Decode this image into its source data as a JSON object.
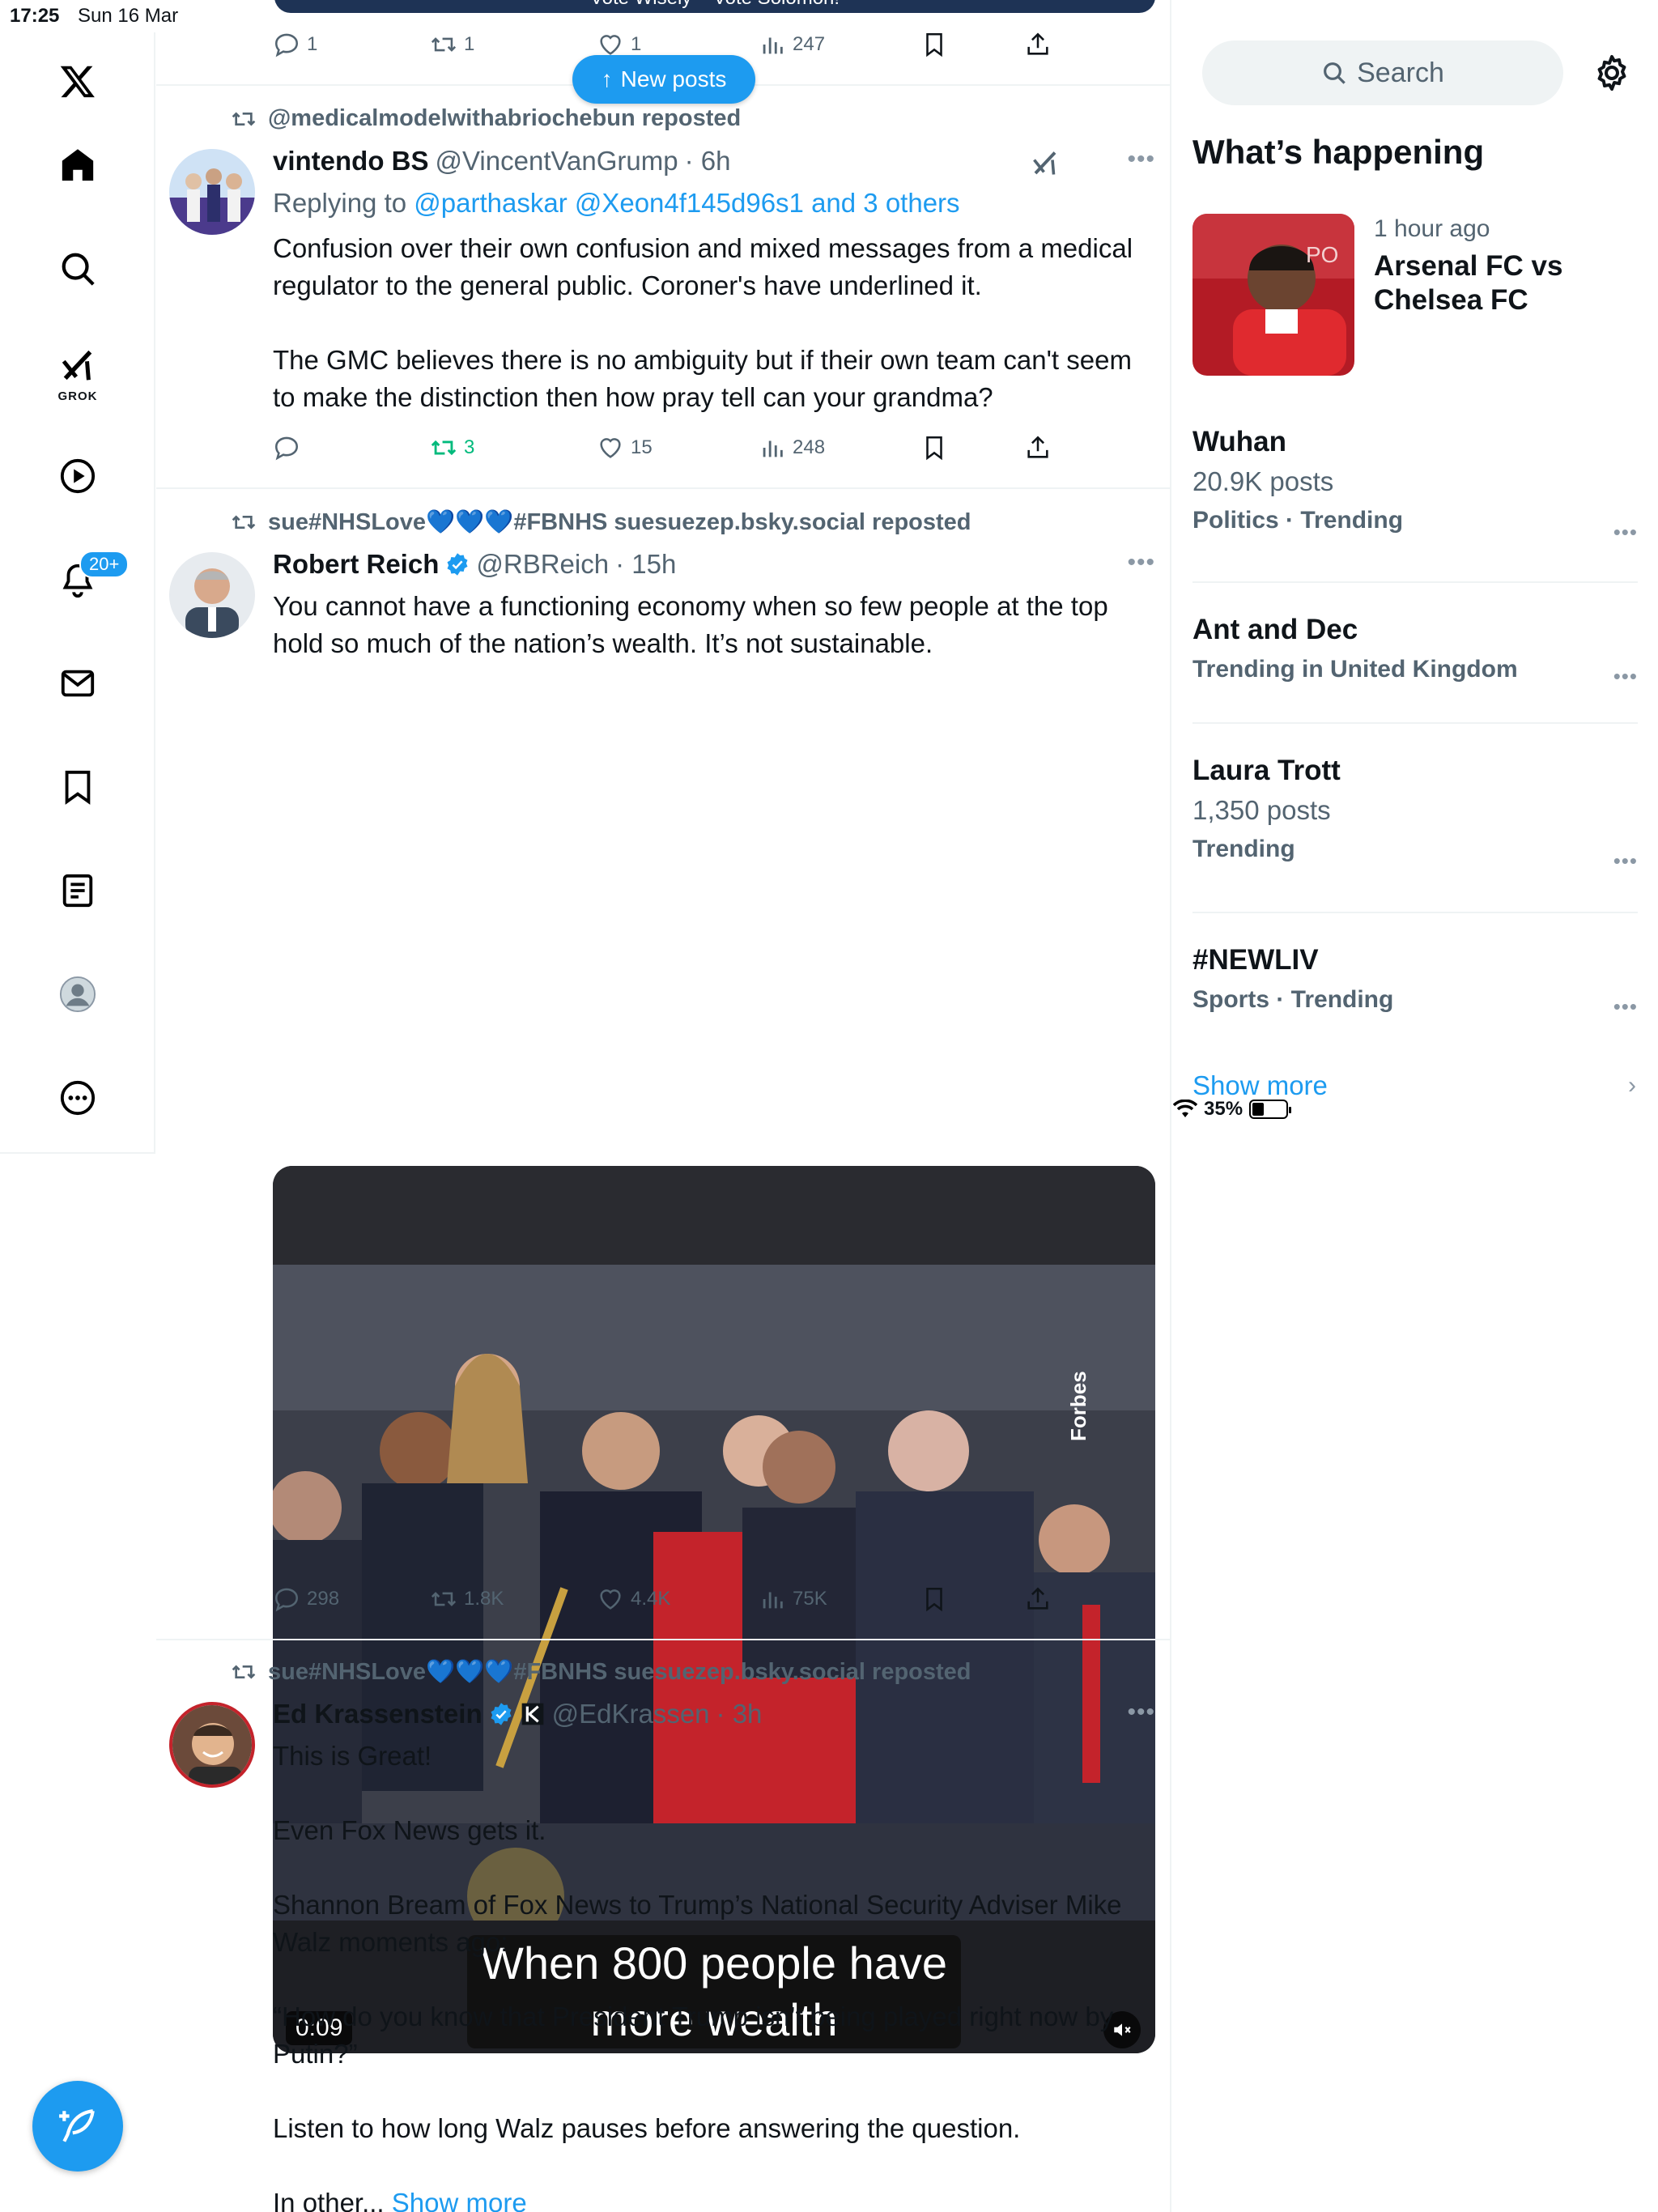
{
  "status_bar": {
    "time": "17:25",
    "date": "Sun 16 Mar",
    "battery": "35%",
    "battery_level": 0.35
  },
  "nav": {
    "notifications_badge": "20+",
    "grok_label": "GROK"
  },
  "banner": {
    "text": "Vote Wisely – Vote Solomon!"
  },
  "new_posts": {
    "label": "New posts"
  },
  "top_actions": {
    "replies": "1",
    "reposts": "1",
    "likes": "1",
    "views": "247"
  },
  "posts": [
    {
      "repost_by": "@medicalmodelwithabriochebun reposted",
      "name": "vintendo BS",
      "handle": "@VincentVanGrump",
      "time": "· 6h",
      "replying_prefix": "Replying to ",
      "replying_to": "@parthaskar @Xeon4f145d96s1 and 3 others",
      "body": [
        "Confusion over their own confusion and mixed messages from a medical regulator to the general public. Coroner's have underlined it.",
        "The GMC believes there is no ambiguity but if their own team can't seem to make the distinction then how pray tell can your grandma?"
      ],
      "actions": {
        "replies": "",
        "reposts": "3",
        "likes": "15",
        "views": "248"
      }
    },
    {
      "repost_by": "sue#NHSLove💙💙💙#FBNHS suesuezep.bsky.social reposted",
      "name": "Robert Reich",
      "handle": "@RBReich",
      "time": "· 15h",
      "body": [
        "You cannot have a functioning economy when so few people at the top hold so much of the nation’s wealth. It’s not sustainable."
      ],
      "video": {
        "caption_line1": "When 800 people have",
        "caption_line2": "more wealth",
        "duration": "0:09",
        "watermark": "Forbes"
      },
      "actions": {
        "replies": "298",
        "reposts": "1.8K",
        "likes": "4.4K",
        "views": "75K"
      }
    },
    {
      "repost_by": "sue#NHSLove💙💙💙#FBNHS suesuezep.bsky.social reposted",
      "name": "Ed Krassenstein",
      "handle": "@EdKrassen",
      "time": "· 3h",
      "body": [
        "This is Great!",
        "Even Fox News gets it.",
        "Shannon Bream of Fox News to Trump’s National Security Adviser Mike Walz moments ago:",
        "“How do you know that President Trump isn’t being played right now by Putin?”",
        "Listen to how long Walz pauses before answering the question."
      ],
      "truncated": "In other...",
      "show_more": "Show more"
    }
  ],
  "sidebar": {
    "search_placeholder": "Search",
    "heading": "What’s happening",
    "featured": {
      "time_ago": "1 hour ago",
      "title": "Arsenal FC vs Chelsea FC"
    },
    "trends": [
      {
        "title": "Wuhan",
        "posts": "20.9K posts",
        "category": "Politics · Trending"
      },
      {
        "title": "Ant and Dec",
        "posts": "",
        "category": "Trending in United Kingdom"
      },
      {
        "title": "Laura Trott",
        "posts": "1,350 posts",
        "category": "Trending"
      },
      {
        "title": "#NEWLIV",
        "posts": "",
        "category": "Sports · Trending"
      }
    ],
    "show_more": "Show more"
  },
  "colors": {
    "accent": "#1d9bf0",
    "text": "#0f1419",
    "muted": "#536471",
    "repost_active": "#00ba7c",
    "border": "#eff3f4"
  }
}
